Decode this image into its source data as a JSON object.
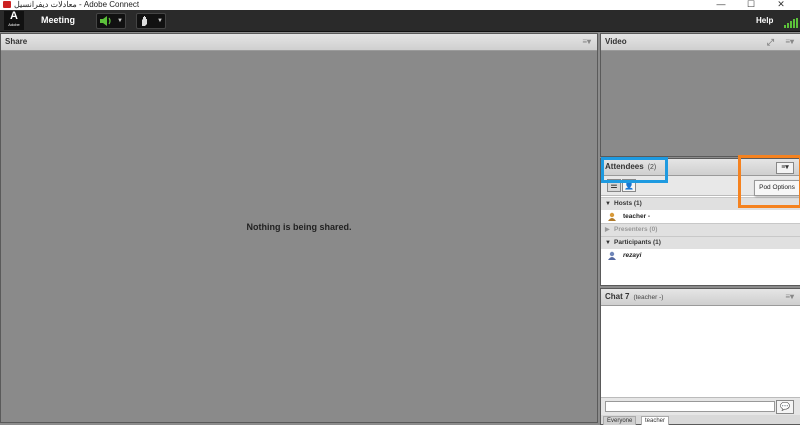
{
  "window": {
    "title": "معادلات دیفرانسیل - Adobe Connect",
    "controls": {
      "minimize": "—",
      "maximize": "☐",
      "close": "✕"
    }
  },
  "menubar": {
    "logo_glyph": "A",
    "logo_text": "Adobe",
    "meeting_label": "Meeting",
    "speaker_icon": "speaker-icon",
    "status_icon": "raise-hand-icon",
    "help_label": "Help",
    "signal_color": "#5cc23a"
  },
  "share": {
    "title": "Share",
    "message": "Nothing is being shared."
  },
  "video": {
    "title": "Video"
  },
  "attendees": {
    "title": "Attendees",
    "count": "(2)",
    "pod_options_tooltip": "Pod Options",
    "groups": [
      {
        "label": "Hosts (1)",
        "people": [
          {
            "name": "teacher -",
            "role": "host"
          }
        ]
      },
      {
        "label": "Presenters (0)",
        "people": []
      },
      {
        "label": "Participants (1)",
        "people": [
          {
            "name": "rezayi",
            "role": "participant"
          }
        ]
      }
    ]
  },
  "chat": {
    "title": "Chat 7",
    "subtitle": "(teacher -)",
    "input_value": "",
    "tabs": [
      {
        "label": "Everyone"
      },
      {
        "label": "teacher"
      }
    ]
  },
  "highlights": {
    "blue": "#1e9ae0",
    "orange": "#f5821f"
  }
}
